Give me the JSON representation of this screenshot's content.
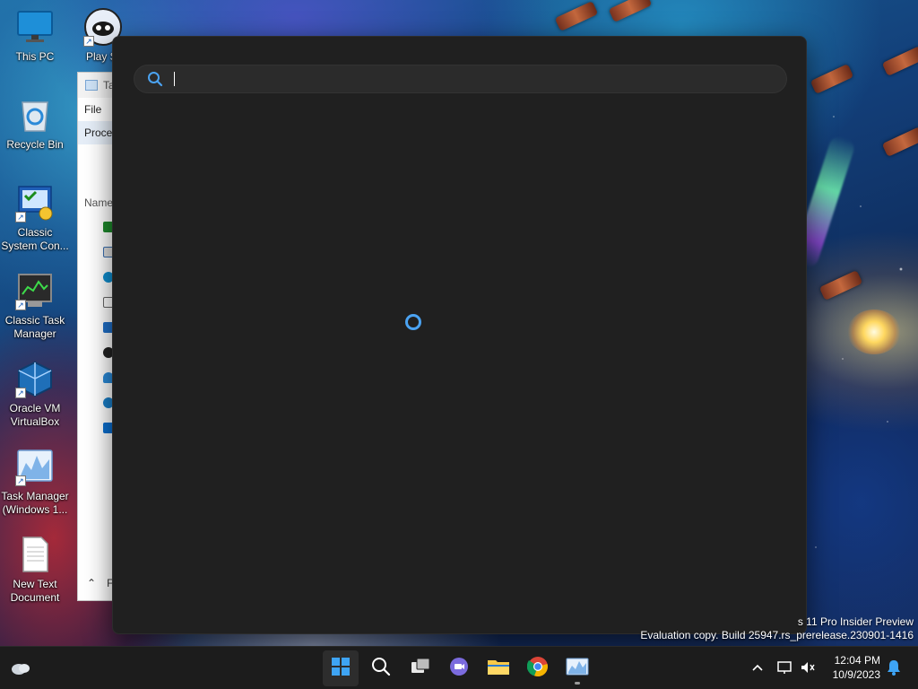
{
  "desktop": {
    "icons": [
      {
        "label": "This PC",
        "icon": "monitor-icon"
      },
      {
        "label": "Play St",
        "icon": "play-store-icon"
      },
      {
        "label": "Recycle Bin",
        "icon": "recycle-bin-icon"
      },
      {
        "label": "Classic\nSystem Con...",
        "icon": "control-panel-icon"
      },
      {
        "label": "Classic Task\nManager",
        "icon": "task-manager-icon"
      },
      {
        "label": "Oracle VM\nVirtualBox",
        "icon": "virtualbox-icon"
      },
      {
        "label": "Task Manager\n(Windows 1...",
        "icon": "task-manager-modern-icon"
      },
      {
        "label": "New Text\nDocument",
        "icon": "text-document-icon"
      }
    ]
  },
  "background_window": {
    "title": "Ta",
    "menu": "File",
    "tab": "Proce",
    "column_header": "Name",
    "footer_label": "F"
  },
  "search": {
    "input_value": "",
    "placeholder": "",
    "accent_color": "#4ba3f2"
  },
  "watermark": {
    "line1": "s 11 Pro Insider Preview",
    "line2": "Evaluation copy. Build 25947.rs_prerelease.230901-1416"
  },
  "taskbar": {
    "apps": [
      "start-icon",
      "search-icon",
      "task-view-icon",
      "teams-chat-icon",
      "file-explorer-icon",
      "chrome-icon",
      "task-manager-icon"
    ],
    "tray": {
      "time": "12:04 PM",
      "date": "10/9/2023"
    }
  }
}
